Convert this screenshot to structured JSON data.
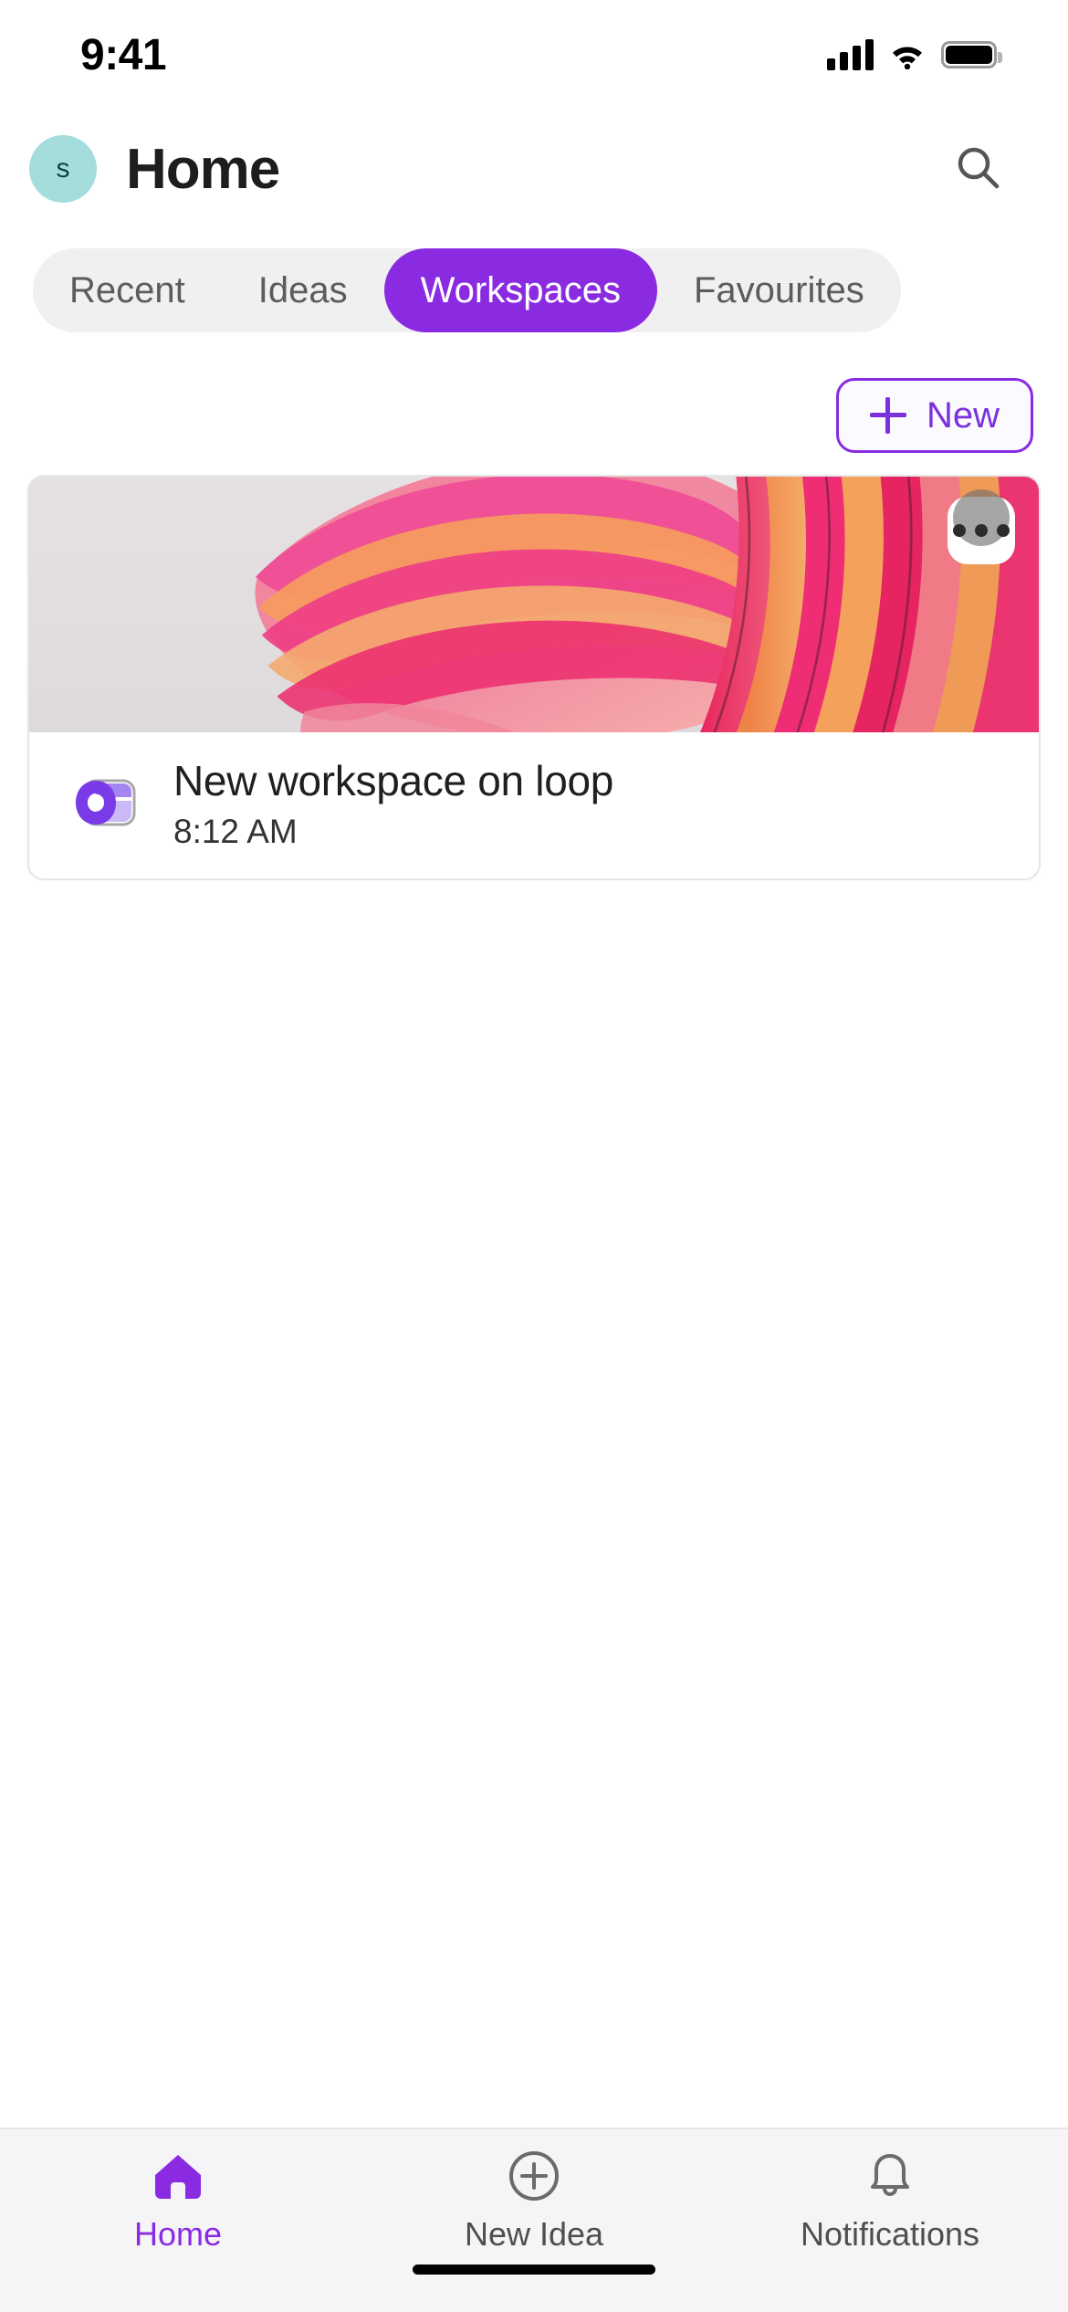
{
  "status_bar": {
    "time": "9:41",
    "cellular_icon": "signal-bars-icon",
    "wifi_icon": "wifi-icon",
    "battery_icon": "battery-full-icon"
  },
  "header": {
    "avatar_initial": "s",
    "avatar_color": "#a5dcdc",
    "title": "Home",
    "search_icon": "search-icon"
  },
  "tabs": {
    "items": [
      {
        "label": "Recent",
        "active": false
      },
      {
        "label": "Ideas",
        "active": false
      },
      {
        "label": "Workspaces",
        "active": true
      },
      {
        "label": "Favourites",
        "active": false
      }
    ],
    "active_color": "#8a2be2",
    "inactive_text_color": "#5c5c5c",
    "track_color": "#f0f0f0"
  },
  "toolbar": {
    "new_label": "New",
    "new_icon": "plus-icon",
    "accent_color": "#7b30dd"
  },
  "workspaces": [
    {
      "title": "New workspace on loop",
      "time": "8:12 AM",
      "app_icon": "microsoft-loop-icon",
      "more_icon": "more-options-icon",
      "cover_description": "abstract layered ribbon artwork in pink, magenta, coral and orange on light grey"
    }
  ],
  "bottom_nav": {
    "items": [
      {
        "label": "Home",
        "icon": "home-icon",
        "active": true
      },
      {
        "label": "New Idea",
        "icon": "plus-circle-icon",
        "active": false
      },
      {
        "label": "Notifications",
        "icon": "bell-icon",
        "active": false
      }
    ],
    "active_color": "#8a2be2",
    "inactive_color": "#4f4f4f"
  }
}
